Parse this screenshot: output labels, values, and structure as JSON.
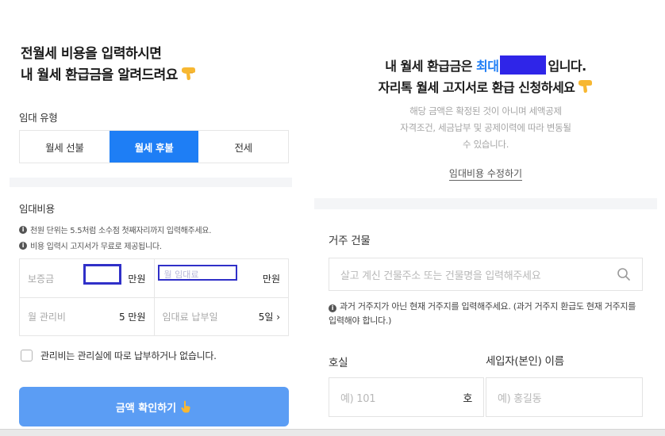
{
  "left": {
    "title_line1": "전월세 비용을 입력하시면",
    "title_line2": "내 월세 환급금을 알려드려요",
    "rent_type_label": "임대 유형",
    "rent_type_options": [
      "월세 선불",
      "월세 후불",
      "전세"
    ],
    "rent_type_selected": "월세 후불",
    "cost_label": "임대비용",
    "info1": "천원 단위는 5.5처럼 소수점 첫째자리까지 입력해주세요.",
    "info2": "비용 입력시 고지서가 무료로 제공됩니다.",
    "deposit_label": "보증금",
    "deposit_unit": "만원",
    "monthly_rent_placeholder": "월 임대료",
    "monthly_rent_unit": "만원",
    "management_fee_label": "월 관리비",
    "management_fee_value": "5 만원",
    "payment_day_label": "임대료 납부일",
    "payment_day_value": "5일 ›",
    "checkbox_label": "관리비는 관리실에 따로 납부하거나 없습니다.",
    "cta_label": "금액 확인하기"
  },
  "right": {
    "title_prefix": "내 월세 환급금은",
    "title_blue": "최대",
    "title_suffix": "입니다.",
    "title_line2": "자리톡 월세 고지서로 환급 신청하세요",
    "sub_line1": "해당 금액은 확정된 것이 아니며 세액공제",
    "sub_line2": "자격조건, 세금납부 및 공제이력에 따라 변동될",
    "sub_line3": "수 있습니다.",
    "edit_link": "임대비용 수정하기",
    "building_label": "거주 건물",
    "building_placeholder": "살고 계신 건물주소 또는 건물명을 입력해주세요",
    "building_info": "과거 거주지가 아닌 현재 거주지를 입력해주세요. (과거 거주지 환급도 현재 거주지를 입력해야 합니다.)",
    "room_label": "호실",
    "room_placeholder": "예) 101",
    "room_unit": "호",
    "tenant_label": "세입자(본인) 이름",
    "tenant_placeholder": "예) 홍길동"
  },
  "colors": {
    "accent": "#1e7ef5",
    "cta": "#5b9df4",
    "redaction": "#2f25e8"
  }
}
